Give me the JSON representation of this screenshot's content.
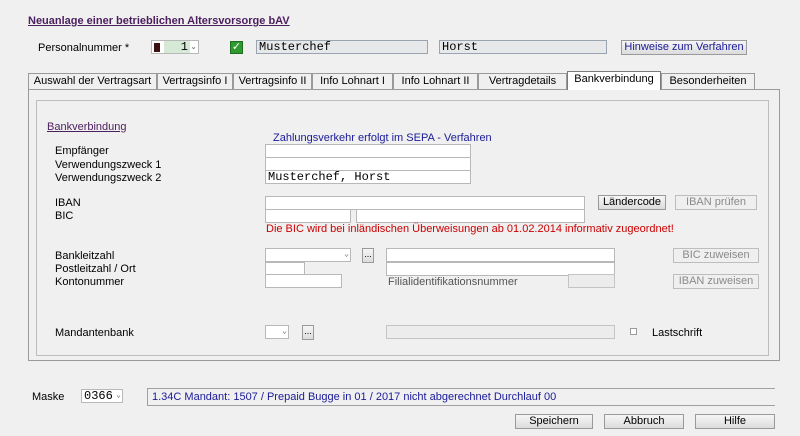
{
  "window": {
    "title": "Neuanlage einer betrieblichen Altersvorsorge bAV"
  },
  "header": {
    "personalnummer_label": "Personalnummer *",
    "personalnummer_value": "1",
    "lastname": "Musterchef",
    "firstname": "Horst",
    "hinweise_button": "Hinweise zum Verfahren"
  },
  "tabs": [
    {
      "label": "Auswahl der Vertragsart"
    },
    {
      "label": "Vertragsinfo I"
    },
    {
      "label": "Vertragsinfo II"
    },
    {
      "label": "Info Lohnart I"
    },
    {
      "label": "Info Lohnart II"
    },
    {
      "label": "Vertragdetails"
    },
    {
      "label": "Bankverbindung"
    },
    {
      "label": "Besonderheiten"
    }
  ],
  "active_tab": "Bankverbindung",
  "bank": {
    "section_title": "Bankverbindung",
    "sepa_note": "Zahlungsverkehr erfolgt im SEPA - Verfahren",
    "empfaenger_label": "Empfänger",
    "empfaenger_value": "",
    "zweck1_label": "Verwendungszweck 1",
    "zweck1_value": "",
    "zweck2_label": "Verwendungszweck 2",
    "zweck2_value": "Musterchef, Horst",
    "iban_label": "IBAN",
    "iban_value": "",
    "bic_label": "BIC",
    "laendercode_button": "Ländercode",
    "iban_pruefen_button": "IBAN prüfen",
    "bic_note": "Die BIC wird bei inländischen Überweisungen ab 01.02.2014 informativ zugeordnet!",
    "bankleitzahl_label": "Bankleitzahl",
    "plz_ort_label": "Postleitzahl / Ort",
    "kontonummer_label": "Kontonummer",
    "filial_label": "Filialidentifikationsnummer",
    "bic_zuweisen_button": "BIC zuweisen",
    "iban_zuweisen_button": "IBAN zuweisen",
    "ellipsis": "...",
    "mandantenbank_label": "Mandantenbank",
    "lastschrift_label": "Lastschrift"
  },
  "footer": {
    "maske_label": "Maske",
    "maske_value": "0366",
    "status_text": "1.34C Mandant: 1507 / Prepaid Bugge in 01 / 2017 nicht abgerechnet   Durchlauf 00",
    "speichern": "Speichern",
    "abbruch": "Abbruch",
    "hilfe": "Hilfe"
  },
  "colors": {
    "title": "#4b1e5e",
    "link_blue": "#1a1a99",
    "note_red": "#cc0000",
    "check_green": "#2f9a2f"
  }
}
